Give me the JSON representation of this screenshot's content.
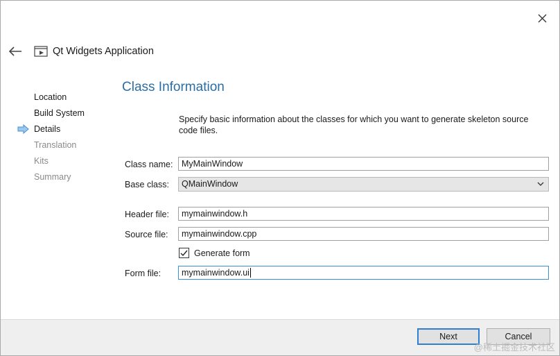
{
  "header": {
    "app_title": "Qt Widgets Application",
    "back_icon": "back-arrow-icon",
    "close_icon": "close-icon",
    "app_icon": "qt-app-icon"
  },
  "nav": {
    "current_icon": "current-step-arrow-icon",
    "items": [
      {
        "label": "Location",
        "state": "done"
      },
      {
        "label": "Build System",
        "state": "done"
      },
      {
        "label": "Details",
        "state": "current"
      },
      {
        "label": "Translation",
        "state": "pending"
      },
      {
        "label": "Kits",
        "state": "pending"
      },
      {
        "label": "Summary",
        "state": "pending"
      }
    ]
  },
  "page": {
    "title": "Class Information",
    "description": "Specify basic information about the classes for which you want to generate skeleton source code files."
  },
  "form": {
    "class_name_label": "Class name:",
    "class_name_value": "MyMainWindow",
    "base_class_label": "Base class:",
    "base_class_value": "QMainWindow",
    "header_file_label": "Header file:",
    "header_file_value": "mymainwindow.h",
    "source_file_label": "Source file:",
    "source_file_value": "mymainwindow.cpp",
    "generate_form_label": "Generate form",
    "generate_form_checked": true,
    "form_file_label": "Form file:",
    "form_file_value": "mymainwindow.ui"
  },
  "footer": {
    "next_label": "Next",
    "cancel_label": "Cancel",
    "watermark": "@稀土掘金技术社区"
  },
  "colors": {
    "accent": "#2a6ea6",
    "focus": "#3a8fd6",
    "footer_bg": "#efefef"
  }
}
